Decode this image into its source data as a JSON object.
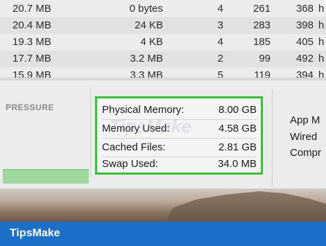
{
  "process_table": {
    "rows": [
      {
        "memory": "20.7 MB",
        "compressed": "0 bytes",
        "threads": "4",
        "ports": "261",
        "pid": "368",
        "extra": "h"
      },
      {
        "memory": "20.4 MB",
        "compressed": "24 KB",
        "threads": "3",
        "ports": "283",
        "pid": "398",
        "extra": "h"
      },
      {
        "memory": "19.3 MB",
        "compressed": "4 KB",
        "threads": "4",
        "ports": "185",
        "pid": "405",
        "extra": "h"
      },
      {
        "memory": "17.7 MB",
        "compressed": "3.2 MB",
        "threads": "2",
        "ports": "99",
        "pid": "492",
        "extra": "h"
      },
      {
        "memory": "15.9 MB",
        "compressed": "3.3 MB",
        "threads": "5",
        "ports": "119",
        "pid": "394",
        "extra": "h"
      }
    ]
  },
  "pressure": {
    "title": "PRESSURE"
  },
  "memory_stats": {
    "physical_memory_label": "Physical Memory:",
    "physical_memory_value": "8.00 GB",
    "memory_used_label": "Memory Used:",
    "memory_used_value": "4.58 GB",
    "cached_files_label": "Cached Files:",
    "cached_files_value": "2.81 GB",
    "swap_used_label": "Swap Used:",
    "swap_used_value": "34.0 MB"
  },
  "right_column": {
    "items": [
      "App M",
      "Wired",
      "Compr"
    ]
  },
  "watermark": "TipsMake",
  "footer": {
    "brand": "TipsMake"
  },
  "colors": {
    "highlight": "#2ec82e",
    "footer": "#1c6fc8",
    "pressure_graph": "#9fd89f"
  }
}
